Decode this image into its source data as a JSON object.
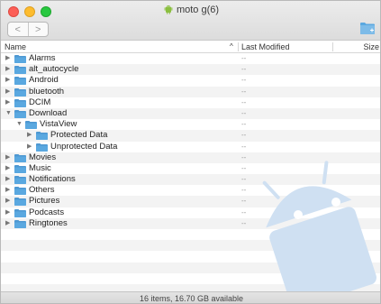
{
  "window": {
    "title": "moto g(6)",
    "nav_back": "<",
    "nav_forward": ">"
  },
  "columns": {
    "name": "Name",
    "sort_indicator": "^",
    "last_modified": "Last Modified",
    "size": "Size"
  },
  "rows": [
    {
      "name": "Alarms",
      "modified": "--",
      "level": 0,
      "expanded": false
    },
    {
      "name": "alt_autocycle",
      "modified": "--",
      "level": 0,
      "expanded": false
    },
    {
      "name": "Android",
      "modified": "--",
      "level": 0,
      "expanded": false
    },
    {
      "name": "bluetooth",
      "modified": "--",
      "level": 0,
      "expanded": false
    },
    {
      "name": "DCIM",
      "modified": "--",
      "level": 0,
      "expanded": false
    },
    {
      "name": "Download",
      "modified": "--",
      "level": 0,
      "expanded": true
    },
    {
      "name": "VistaView",
      "modified": "--",
      "level": 1,
      "expanded": true
    },
    {
      "name": "Protected Data",
      "modified": "--",
      "level": 2,
      "expanded": false
    },
    {
      "name": "Unprotected Data",
      "modified": "--",
      "level": 2,
      "expanded": false
    },
    {
      "name": "Movies",
      "modified": "--",
      "level": 0,
      "expanded": false
    },
    {
      "name": "Music",
      "modified": "--",
      "level": 0,
      "expanded": false
    },
    {
      "name": "Notifications",
      "modified": "--",
      "level": 0,
      "expanded": false
    },
    {
      "name": "Others",
      "modified": "--",
      "level": 0,
      "expanded": false
    },
    {
      "name": "Pictures",
      "modified": "--",
      "level": 0,
      "expanded": false
    },
    {
      "name": "Podcasts",
      "modified": "--",
      "level": 0,
      "expanded": false
    },
    {
      "name": "Ringtones",
      "modified": "--",
      "level": 0,
      "expanded": false
    }
  ],
  "status": {
    "text": "16 items, 16.70 GB available"
  },
  "icons": {
    "folder": "folder-icon",
    "disclosure_open": "disclosure-open-icon",
    "disclosure_closed": "disclosure-closed-icon",
    "new_folder": "new-folder-icon",
    "title": "android-icon"
  },
  "colors": {
    "folder": "#5aa8e0",
    "folder_tab": "#4e98d2",
    "watermark": "#cfe0f2"
  }
}
